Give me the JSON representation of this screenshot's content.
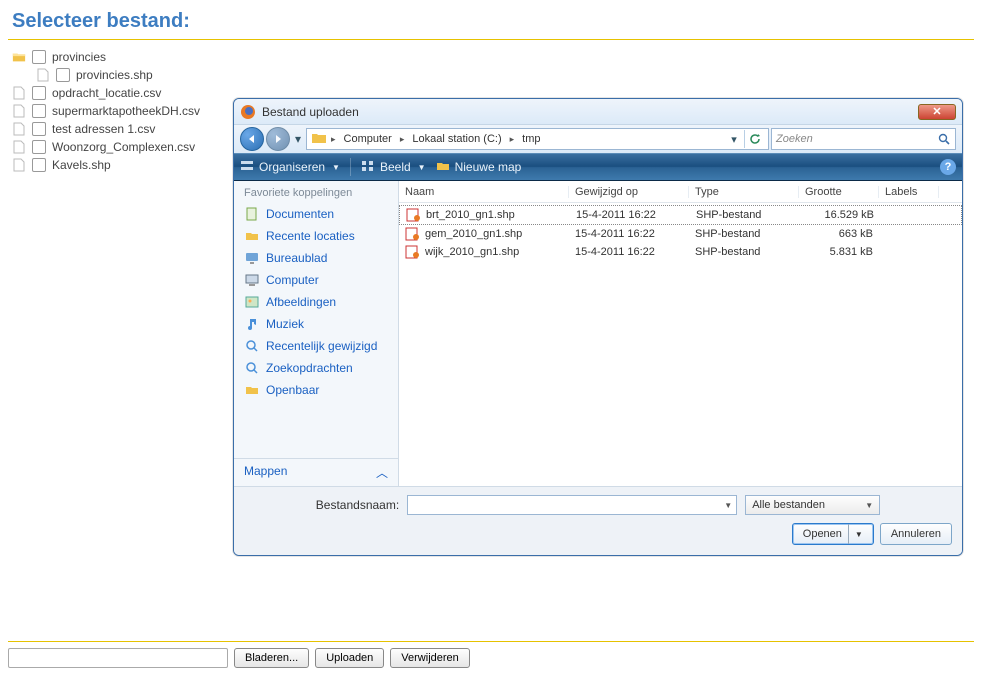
{
  "page": {
    "title": "Selecteer bestand:"
  },
  "tree": {
    "folder": "provincies",
    "files": [
      "provincies.shp",
      "opdracht_locatie.csv",
      "supermarktapotheekDH.csv",
      "test adressen 1.csv",
      "Woonzorg_Complexen.csv",
      "Kavels.shp"
    ]
  },
  "bottom": {
    "browse": "Bladeren...",
    "upload": "Uploaden",
    "delete": "Verwijderen"
  },
  "dialog": {
    "title": "Bestand uploaden",
    "breadcrumb": {
      "root": "Computer",
      "drive": "Lokaal station (C:)",
      "folder": "tmp"
    },
    "search_placeholder": "Zoeken",
    "toolbar": {
      "organize": "Organiseren",
      "view": "Beeld",
      "newfolder": "Nieuwe map"
    },
    "sidebar": {
      "header": "Favoriete koppelingen",
      "items": [
        "Documenten",
        "Recente locaties",
        "Bureaublad",
        "Computer",
        "Afbeeldingen",
        "Muziek",
        "Recentelijk gewijzigd",
        "Zoekopdrachten",
        "Openbaar"
      ],
      "folders": "Mappen"
    },
    "columns": {
      "name": "Naam",
      "modified": "Gewijzigd op",
      "type": "Type",
      "size": "Grootte",
      "labels": "Labels"
    },
    "files": [
      {
        "name": "brt_2010_gn1.shp",
        "modified": "15-4-2011 16:22",
        "type": "SHP-bestand",
        "size": "16.529 kB",
        "selected": true
      },
      {
        "name": "gem_2010_gn1.shp",
        "modified": "15-4-2011 16:22",
        "type": "SHP-bestand",
        "size": "663 kB",
        "selected": false
      },
      {
        "name": "wijk_2010_gn1.shp",
        "modified": "15-4-2011 16:22",
        "type": "SHP-bestand",
        "size": "5.831 kB",
        "selected": false
      }
    ],
    "footer": {
      "filename_label": "Bestandsnaam:",
      "filetype": "Alle bestanden",
      "open": "Openen",
      "cancel": "Annuleren"
    }
  }
}
